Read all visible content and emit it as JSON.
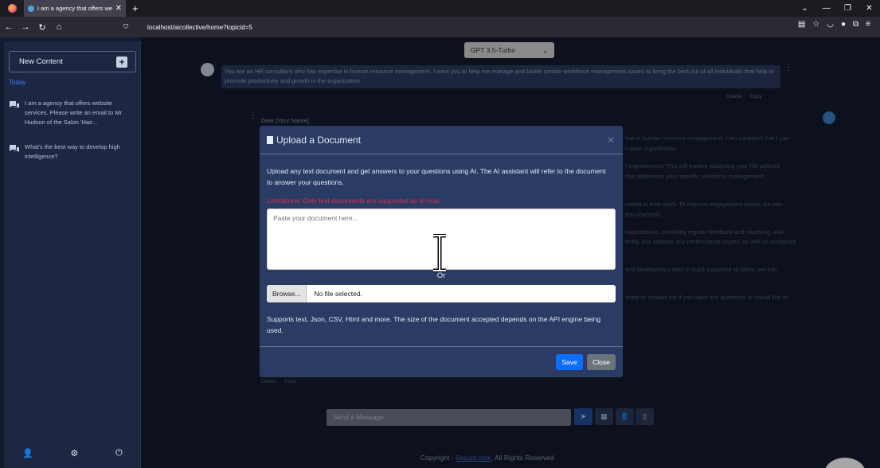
{
  "browser": {
    "tab_title": "I am a agency that offers websi",
    "url": "localhost/aicollective/home?topicid=5"
  },
  "sidebar": {
    "new_content": "New Content",
    "section": "Today",
    "conversations": [
      {
        "text": "I am a agency that offers website services. Please write an email to Mr. Hudson of the Salon 'Hair..."
      },
      {
        "text": "What's the best way to develop high intelligence?"
      }
    ]
  },
  "model": {
    "selected": "GPT 3.5-Turbo"
  },
  "chat": {
    "user_message": "You are an HR consultant who has expertise in human resource management. I want you to help me manage and tackle certain workforce management issues to bring the best out of all individuals that help to promote productivity and growth in the organization.",
    "delete": "Delete",
    "copy": "Copy",
    "reply_greeting": "Dear [Your Name],",
    "reply_lines": [
      "tise in human resource management, I am confident that I can",
      "n your organization.",
      "f improvement. This will involve analyzing your HR policies",
      "that addresses your specific workforce management",
      "mitted to their work. To improve engagement levels, we can",
      "tion channels.",
      "expectations, providing regular feedback and coaching, and",
      "entify and address any performance issues, as well as recognize",
      "and developing a plan to build a pipeline of talent, we can",
      "sitate to contact me if you have any questions or would like to"
    ],
    "input_placeholder": "Send a Message"
  },
  "footer": {
    "prefix": "Copyright - ",
    "link": "Secuirt.com",
    "suffix": ", All Rights Reserved"
  },
  "modal": {
    "title": "Upload a Document",
    "description": "Upload any text document and get answers to your questions using AI. The AI assistant will refer to the document to answer your questions.",
    "limitation": "Limitations: Only text documents are supported as of now.",
    "textarea_placeholder": "Paste your document here...",
    "or": "Or",
    "browse": "Browse...",
    "file_status": "No file selected.",
    "supports": "Supports text, Json, CSV, Html and more. The size of the document accepted depends on the API engine being used.",
    "save": "Save",
    "close": "Close"
  }
}
